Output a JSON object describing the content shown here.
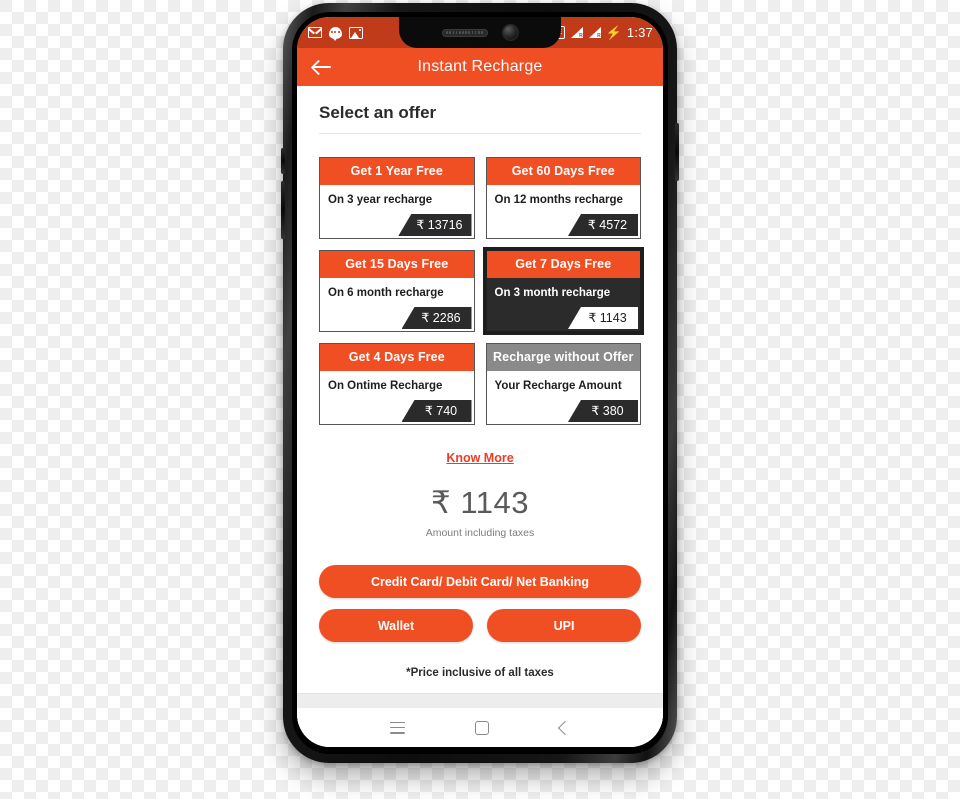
{
  "status_bar": {
    "left_icons": [
      "mail-icon",
      "chat-icon",
      "photo-icon"
    ],
    "wifi_label": "R",
    "volte_label": "VoLTE",
    "signal_label": "R",
    "charging_icon": "⚡",
    "time": "1:37"
  },
  "app_bar": {
    "back_label": "back-arrow",
    "title": "Instant Recharge"
  },
  "section": {
    "title": "Select an offer"
  },
  "offers": [
    {
      "headline": "Get 1 Year Free",
      "description": "On 3 year recharge",
      "price": "₹ 13716",
      "selected": false,
      "header_style": "orange"
    },
    {
      "headline": "Get 60 Days Free",
      "description": "On 12 months recharge",
      "price": "₹ 4572",
      "selected": false,
      "header_style": "orange"
    },
    {
      "headline": "Get 15 Days Free",
      "description": "On 6 month recharge",
      "price": "₹ 2286",
      "selected": false,
      "header_style": "orange"
    },
    {
      "headline": "Get 7 Days Free",
      "description": "On 3 month recharge",
      "price": "₹ 1143",
      "selected": true,
      "header_style": "orange"
    },
    {
      "headline": "Get 4 Days Free",
      "description": "On Ontime Recharge",
      "price": "₹ 740",
      "selected": false,
      "header_style": "orange"
    },
    {
      "headline": "Recharge without Offer",
      "description": "Your Recharge Amount",
      "price": "₹ 380",
      "selected": false,
      "header_style": "gray"
    }
  ],
  "know_more": {
    "label": "Know More"
  },
  "amount": {
    "value": "₹ 1143",
    "caption": "Amount including taxes"
  },
  "payment": {
    "primary_label": "Credit Card/ Debit Card/ Net Banking",
    "wallet_label": "Wallet",
    "upi_label": "UPI"
  },
  "footer": {
    "price_note": "*Price inclusive of all taxes"
  },
  "nav_bar": {
    "recents": "recents-icon",
    "home": "home-icon",
    "back": "back-icon"
  },
  "colors": {
    "brand_orange": "#f04e23",
    "status_orange": "#c03b19",
    "link_red": "#ef3b24",
    "dark": "#2b2b2b",
    "gray_header": "#8a8a8a"
  }
}
